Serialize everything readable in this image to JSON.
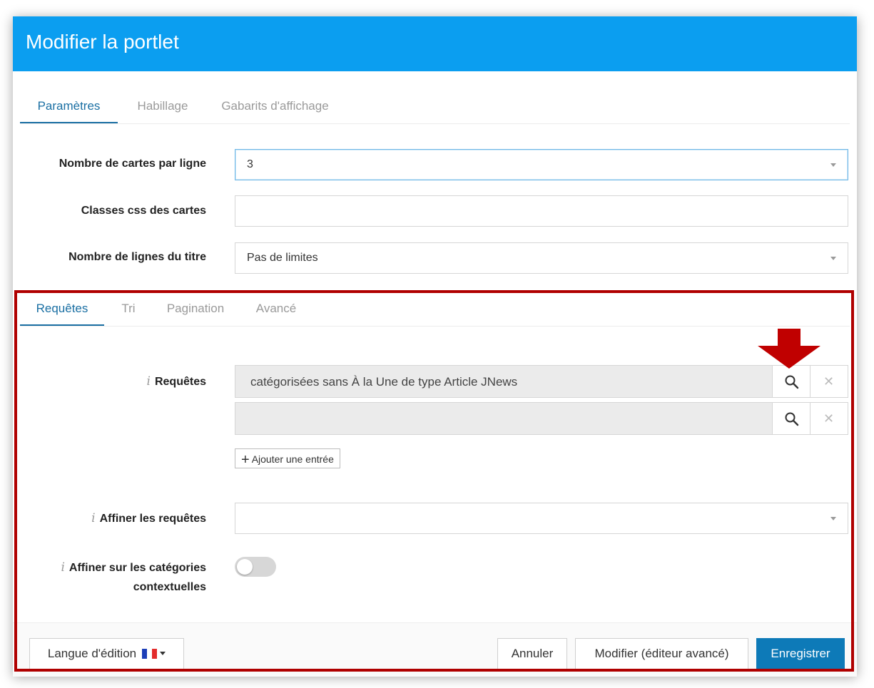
{
  "dialog": {
    "title": "Modifier la portlet"
  },
  "main_tabs": [
    {
      "label": "Paramètres",
      "active": true
    },
    {
      "label": "Habillage",
      "active": false
    },
    {
      "label": "Gabarits d'affichage",
      "active": false
    }
  ],
  "settings": {
    "cards_per_row": {
      "label": "Nombre de cartes par ligne",
      "value": "3"
    },
    "card_css": {
      "label": "Classes css des cartes",
      "value": ""
    },
    "title_lines": {
      "label": "Nombre de lignes du titre",
      "value": "Pas de limites"
    }
  },
  "sub_tabs": [
    {
      "label": "Requêtes",
      "active": true
    },
    {
      "label": "Tri",
      "active": false
    },
    {
      "label": "Pagination",
      "active": false
    },
    {
      "label": "Avancé",
      "active": false
    }
  ],
  "queries": {
    "info": "i",
    "label": "Requêtes",
    "entries": [
      "catégorisées sans À la Une de type Article JNews",
      ""
    ],
    "add_label": "Ajouter une entrée",
    "add_plus": "+",
    "close_glyph": "✕"
  },
  "refine": {
    "info": "i",
    "label": "Affiner les requêtes",
    "value": ""
  },
  "contextual": {
    "info": "i",
    "label_line1": "Affiner sur les catégories",
    "label_line2": "contextuelles",
    "enabled": false
  },
  "footer": {
    "language_label": "Langue d'édition",
    "cancel_label": "Annuler",
    "advanced_label": "Modifier (éditeur avancé)",
    "save_label": "Enregistrer"
  },
  "colors": {
    "header": "#0b9ef0",
    "primary": "#0d7ab8",
    "highlight": "#b00000"
  }
}
